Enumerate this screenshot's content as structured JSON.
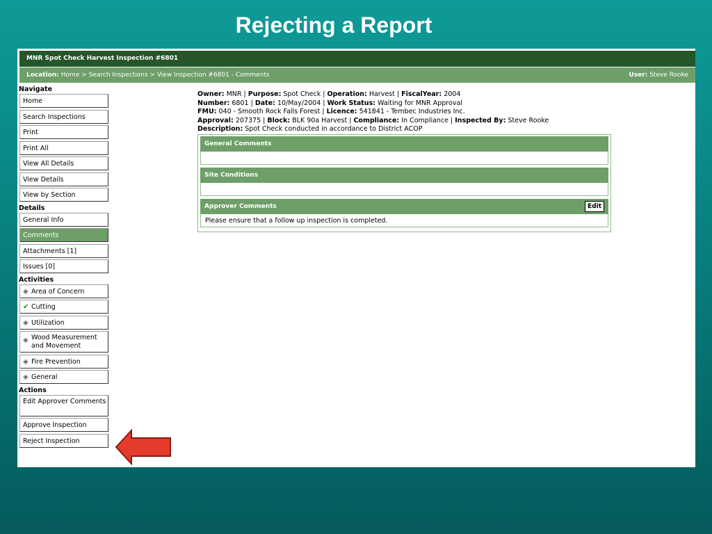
{
  "slide": {
    "title": "Rejecting a Report"
  },
  "app": {
    "window_title": "MNR Spot Check Harvest Inspection #6801",
    "location_label": "Location:",
    "location_path": "Home > Search Inspections > View Inspection #6801 - Comments",
    "user_label": "User:",
    "user_name": "Steve Rooke"
  },
  "sidebar": {
    "navigate_heading": "Navigate",
    "navigate": [
      "Home",
      "Search Inspections",
      "Print",
      "Print All",
      "View All Details",
      "View Details",
      "View by Section"
    ],
    "details_heading": "Details",
    "details": [
      "General Info",
      "Comments",
      "Attachments [1]",
      "Issues [0]"
    ],
    "activities_heading": "Activities",
    "activities": [
      "Area of Concern",
      "Cutting",
      "Utilization",
      "Wood Measurement and Movement",
      "Fire Prevention",
      "General"
    ],
    "actions_heading": "Actions",
    "actions": [
      "Edit Approver Comments",
      "Approve Inspection",
      "Reject Inspection"
    ]
  },
  "inspection": {
    "owner_label": "Owner:",
    "owner": "MNR",
    "purpose_label": "Purpose:",
    "purpose": "Spot Check",
    "operation_label": "Operation:",
    "operation": "Harvest",
    "fiscal_year_label": "FiscalYear:",
    "fiscal_year": "2004",
    "number_label": "Number:",
    "number": "6801",
    "date_label": "Date:",
    "date": "10/May/2004",
    "work_status_label": "Work Status:",
    "work_status": "Waiting for MNR Approval",
    "fmu_label": "FMU:",
    "fmu": "040 - Smooth Rock Falls Forest",
    "licence_label": "Licence:",
    "licence": "541841 - Tembec Industries Inc.",
    "approval_label": "Approval:",
    "approval": "207375",
    "block_label": "Block:",
    "block": "BLK 90a Harvest",
    "compliance_label": "Compliance:",
    "compliance": "In Compliance",
    "inspected_by_label": "Inspected By:",
    "inspected_by": "Steve Rooke",
    "description_label": "Description:",
    "description": "Spot Check conducted in accordance to District ACOP"
  },
  "comments": {
    "general_heading": "General Comments",
    "general_text": "",
    "site_heading": "Site Conditions",
    "site_text": "",
    "approver_heading": "Approver Comments",
    "edit_label": "Edit",
    "approver_text": "Please ensure that a follow up inspection is completed."
  },
  "colors": {
    "titlebar": "#24562a",
    "section_green": "#6e9f68",
    "arrow_fill": "#e53b2b",
    "arrow_stroke": "#8a1a10"
  },
  "icons": {
    "activity_default": "diamond-icon",
    "activity_cutting": "checkmark-icon",
    "pointer": "red-left-arrow"
  }
}
